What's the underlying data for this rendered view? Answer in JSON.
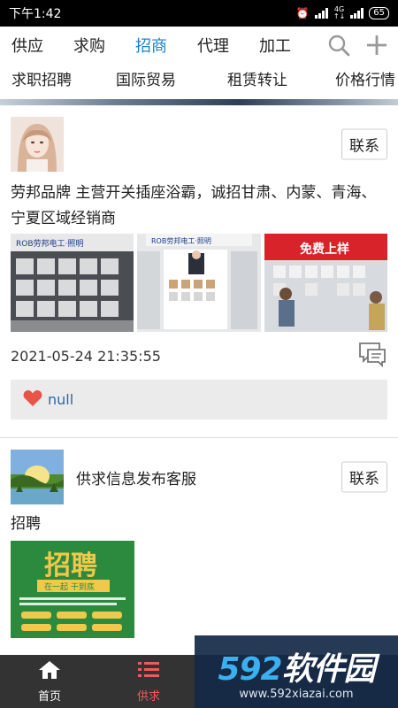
{
  "status_bar": {
    "time": "下午1:42",
    "network": "4G",
    "battery": "65"
  },
  "nav": {
    "tabs": [
      {
        "label": "供应",
        "active": false
      },
      {
        "label": "求购",
        "active": false
      },
      {
        "label": "招商",
        "active": true
      },
      {
        "label": "代理",
        "active": false
      },
      {
        "label": "加工",
        "active": false
      }
    ],
    "categories": [
      "求职招聘",
      "国际贸易",
      "租赁转让",
      "价格行情"
    ],
    "search_icon": "search-icon",
    "add_icon": "plus-icon"
  },
  "posts": [
    {
      "contact_label": "联系",
      "text": "劳邦品牌 主营开关插座浴霸，诚招甘肃、内蒙、青海、宁夏区域经销商",
      "images": [
        "ROB劳邦电工·照明",
        "ROB劳邦电工·照明",
        "免费上样"
      ],
      "timestamp": "2021-05-24 21:35:55",
      "likes": "null"
    },
    {
      "author": "供求信息发布客服",
      "contact_label": "联系",
      "text": "招聘",
      "image_text": [
        "招聘",
        "在一起 干到底"
      ]
    }
  ],
  "tabbar": {
    "items": [
      {
        "label": "首页",
        "icon": "home-icon",
        "active": false
      },
      {
        "label": "供求",
        "icon": "list-icon",
        "active": true
      }
    ]
  },
  "watermark": {
    "logo_num": "592",
    "logo_text": "软件园",
    "url": "www.592xiazai.com"
  },
  "colors": {
    "accent": "#1e7fc8",
    "tab_active": "#f05a5a",
    "like_heart": "#e8534a"
  }
}
